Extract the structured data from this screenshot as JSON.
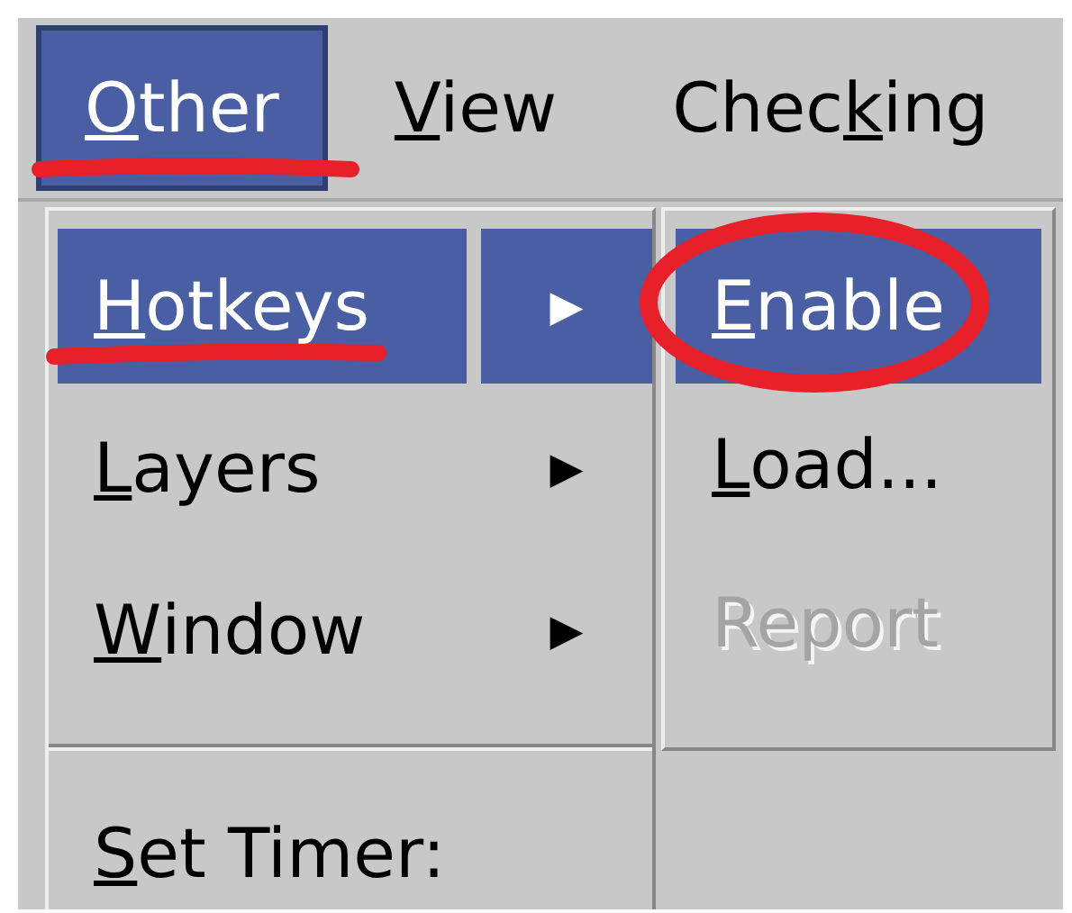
{
  "menubar": [
    {
      "key": "O",
      "after": "ther",
      "selected": true
    },
    {
      "key": "V",
      "after": "iew",
      "selected": false
    },
    {
      "before": "Chec",
      "key": "k",
      "after": "ing",
      "selected": false
    }
  ],
  "menu": {
    "items": [
      {
        "kind": "submenu",
        "key": "H",
        "after": "otkeys",
        "selected": true,
        "arrow": "▶"
      },
      {
        "kind": "submenu",
        "key": "L",
        "after": "ayers",
        "selected": false,
        "arrow": "▶"
      },
      {
        "kind": "submenu",
        "key": "W",
        "after": "indow",
        "selected": false,
        "arrow": "▶"
      },
      {
        "kind": "separator"
      },
      {
        "kind": "item",
        "key": "S",
        "after": "et Timer:",
        "selected": false
      }
    ]
  },
  "submenu": {
    "items": [
      {
        "key": "E",
        "after": "nable",
        "selected": true,
        "disabled": false
      },
      {
        "key": "L",
        "after": "oad...",
        "selected": false,
        "disabled": false
      },
      {
        "before": "Report",
        "selected": false,
        "disabled": true
      }
    ]
  }
}
